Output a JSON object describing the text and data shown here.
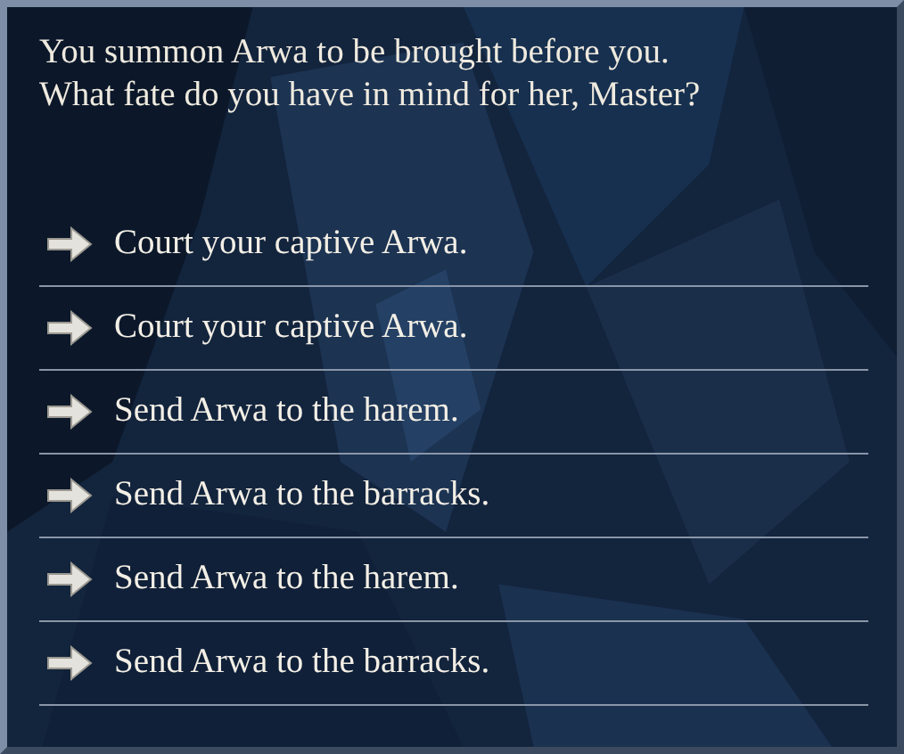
{
  "prompt": "You summon Arwa to be brought before you.\nWhat fate do you have in mind for her, Master?",
  "options": [
    {
      "label": "Court your captive Arwa."
    },
    {
      "label": "Court your captive Arwa."
    },
    {
      "label": "Send Arwa to the harem."
    },
    {
      "label": "Send Arwa to the barracks."
    },
    {
      "label": "Send Arwa to the harem."
    },
    {
      "label": "Send Arwa to the barracks."
    }
  ]
}
